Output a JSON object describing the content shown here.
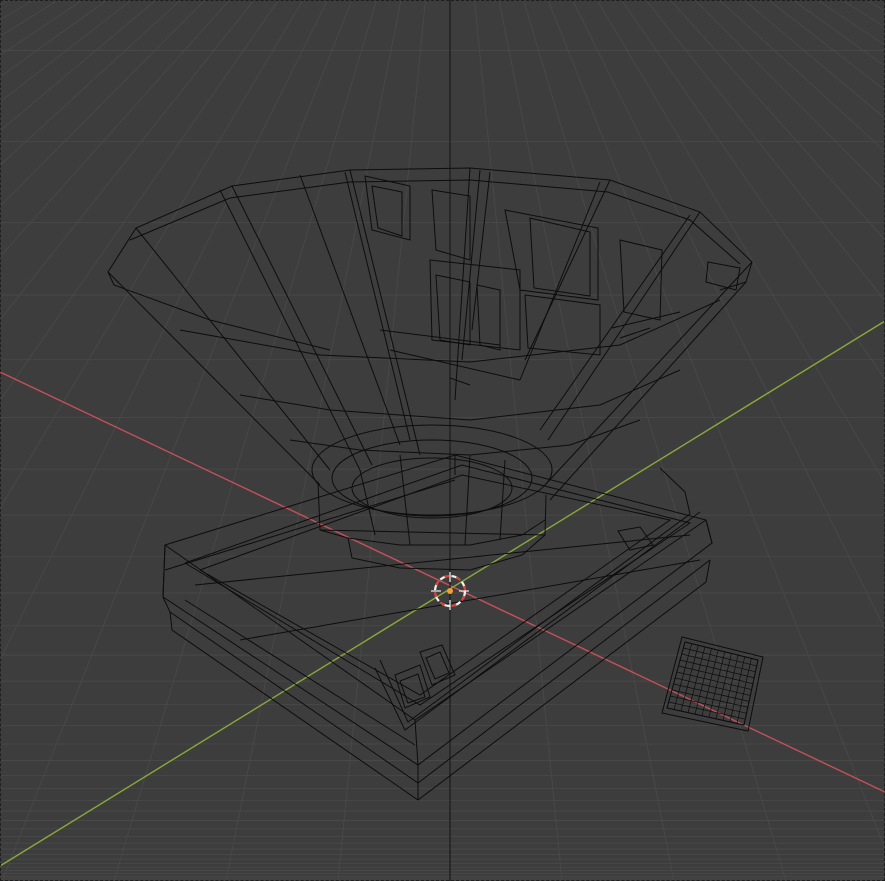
{
  "viewport": {
    "mode": "wireframe",
    "background_color": "#3d3d3d",
    "grid_color": "#4a4a4a",
    "x_axis_color": "#c4505a",
    "y_axis_color": "#8aa83a",
    "z_axis_color": "#1a1a1a",
    "wire_color": "#0d0d0d",
    "cursor_color": "#f0f0f0",
    "cursor_accent_color": "#d8453b",
    "origin_color": "#f0a030"
  },
  "objects": [
    {
      "name": "funnel",
      "icon": "funnel-mesh-icon"
    },
    {
      "name": "scale-base",
      "icon": "scale-base-mesh-icon"
    },
    {
      "name": "small-tile",
      "icon": "tile-mesh-icon"
    }
  ],
  "cursor": {
    "icon": "3d-cursor-icon"
  }
}
